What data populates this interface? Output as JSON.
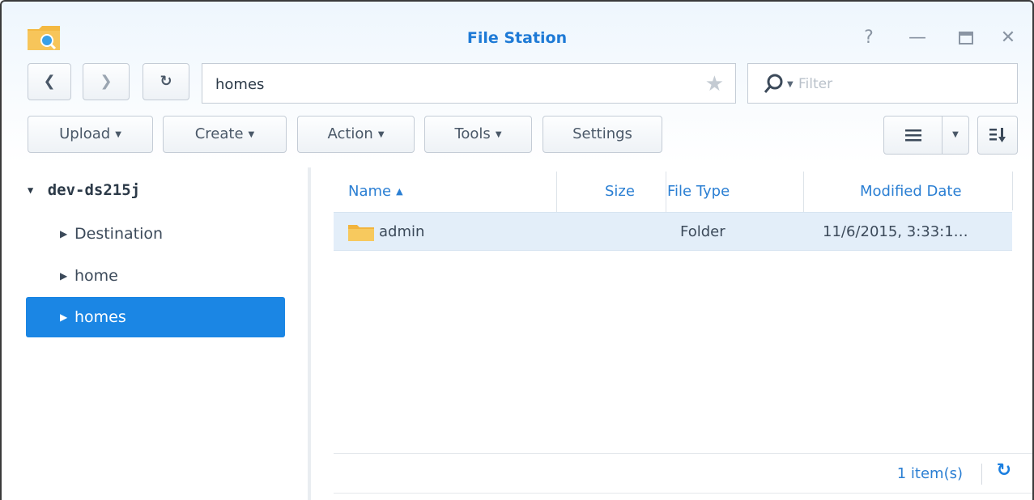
{
  "window": {
    "title": "File Station"
  },
  "navigation": {
    "address": "homes",
    "filter_placeholder": "Filter"
  },
  "toolbar": {
    "upload": "Upload",
    "create": "Create",
    "action": "Action",
    "tools": "Tools",
    "settings": "Settings"
  },
  "tree": {
    "root": "dev-ds215j",
    "items": [
      {
        "label": "Destination",
        "selected": false
      },
      {
        "label": "home",
        "selected": false
      },
      {
        "label": "homes",
        "selected": true
      }
    ]
  },
  "grid": {
    "columns": {
      "name": "Name",
      "size": "Size",
      "type": "File Type",
      "date": "Modified Date"
    },
    "rows": [
      {
        "name": "admin",
        "size": "",
        "type": "Folder",
        "date": "11/6/2015, 3:33:1…"
      }
    ]
  },
  "status": {
    "count": "1 item(s)"
  },
  "colors": {
    "accent": "#1b86e4",
    "title": "#1e7ad6",
    "selected_row": "#e3eef9"
  }
}
